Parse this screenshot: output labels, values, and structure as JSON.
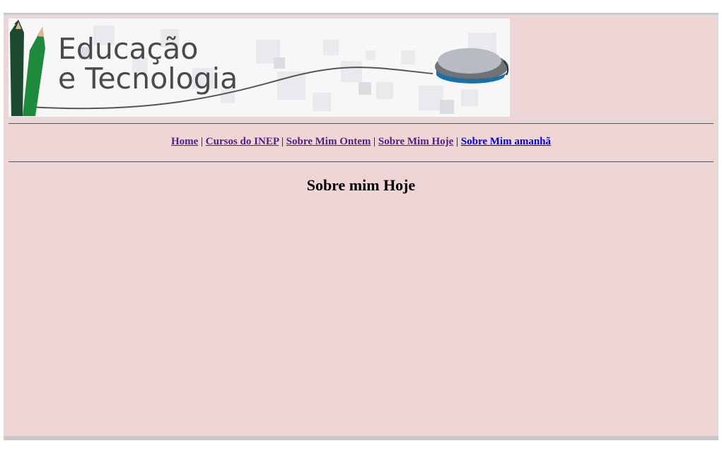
{
  "banner": {
    "line1": "Educação",
    "line2": "e Tecnologia"
  },
  "nav": {
    "items": [
      {
        "label": "Home",
        "visited": true
      },
      {
        "label": "Cursos do INEP",
        "visited": true
      },
      {
        "label": "Sobre Mim Ontem",
        "visited": true
      },
      {
        "label": "Sobre Mim Hoje",
        "visited": true
      },
      {
        "label": "Sobre Mim amanhã",
        "visited": false
      }
    ],
    "separator": "|"
  },
  "page": {
    "title": "Sobre mim Hoje"
  },
  "colors": {
    "background": "#eed6d6",
    "visited_link": "#551a8b",
    "link": "#0000ee"
  }
}
